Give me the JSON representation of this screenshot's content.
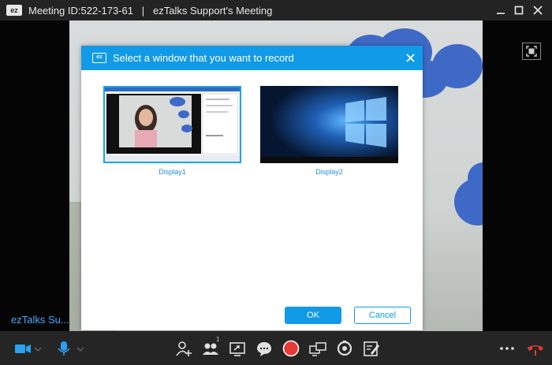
{
  "window": {
    "app_logo": "ez",
    "title": "Meeting ID:522-173-61   |   ezTalks Support's Meeting",
    "buttons": [
      "minimize-icon",
      "maximize-icon",
      "close-icon"
    ]
  },
  "video": {
    "participant_name": "ezTalks Su..."
  },
  "dialog": {
    "icon_text": "ez",
    "title": "Select a window that you want to record",
    "options": [
      {
        "label": "Display1",
        "selected": true
      },
      {
        "label": "Display2",
        "selected": false
      }
    ],
    "ok_label": "OK",
    "cancel_label": "Cancel"
  },
  "toolbar": {
    "participants_count": "1",
    "icons": [
      "video-camera-icon",
      "microphone-icon",
      "invite-icon",
      "participants-icon",
      "share-screen-icon",
      "chat-icon",
      "record-icon",
      "layout-icon",
      "timer-icon",
      "whiteboard-icon",
      "more-icon",
      "hang-up-icon"
    ]
  },
  "colors": {
    "accent": "#109ae8",
    "record": "#e53935",
    "hangup": "#e53935",
    "titlebar": "#232323",
    "toolbar": "#252525"
  }
}
